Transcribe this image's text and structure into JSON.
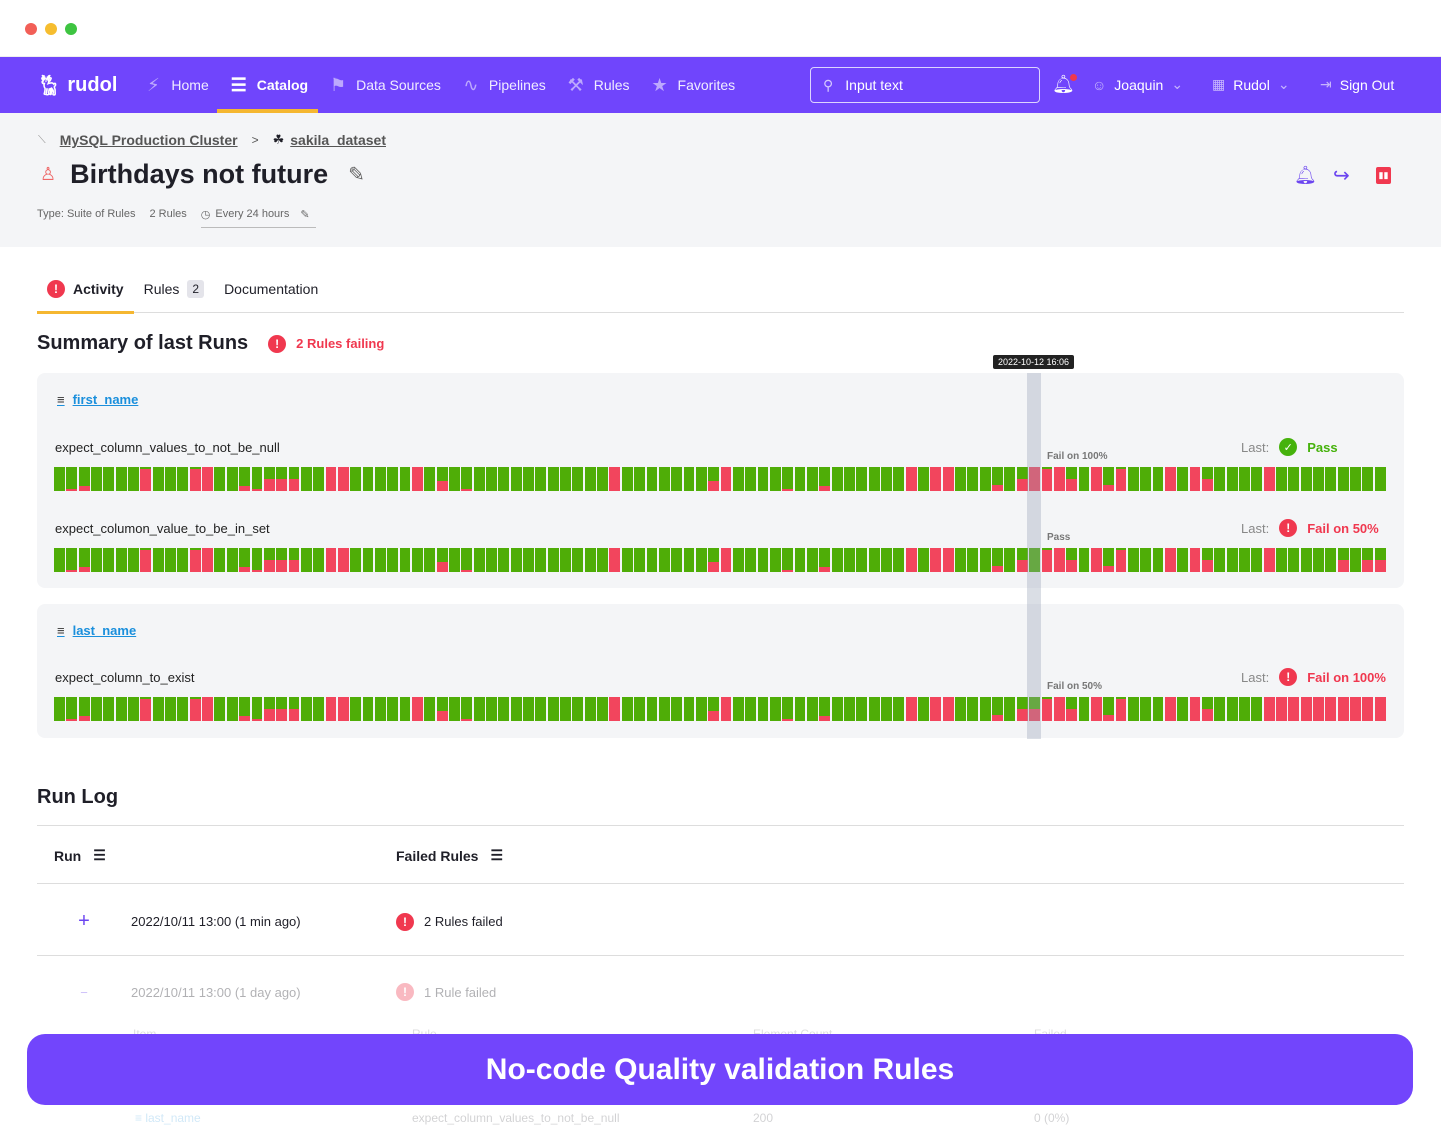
{
  "window": {
    "dots": [
      "#f25f57",
      "#f6bd2f",
      "#3ec441"
    ]
  },
  "nav": {
    "brand": "rudol",
    "items": [
      {
        "label": "Home",
        "icon": "lightning-icon"
      },
      {
        "label": "Catalog",
        "icon": "list-icon",
        "active": true
      },
      {
        "label": "Data Sources",
        "icon": "flag-icon"
      },
      {
        "label": "Pipelines",
        "icon": "route-icon"
      },
      {
        "label": "Rules",
        "icon": "tools-icon"
      },
      {
        "label": "Favorites",
        "icon": "star-icon"
      }
    ],
    "search_placeholder": "Input text",
    "user": "Joaquin",
    "org": "Rudol",
    "signout": "Sign Out"
  },
  "breadcrumb": {
    "source": "MySQL Production Cluster",
    "sep": ">",
    "dataset": "sakila_dataset"
  },
  "page": {
    "title": "Birthdays not future",
    "type": "Type: Suite of Rules",
    "rules_count": "2 Rules",
    "schedule": "Every 24 hours"
  },
  "tabs": [
    {
      "label": "Activity",
      "active": true
    },
    {
      "label": "Rules",
      "badge": "2"
    },
    {
      "label": "Documentation"
    }
  ],
  "summary": {
    "title": "Summary of last Runs",
    "failing": "2 Rules failing",
    "tooltip": "2022-10-12 16:06",
    "last_label": "Last:",
    "highlight_index": 79,
    "groups": [
      {
        "column": "first_name",
        "rules": [
          {
            "name": "expect_column_values_to_not_be_null",
            "hover": "Fail on 100%",
            "last": "Pass",
            "last_status": "pass",
            "fail": [
              0,
              0.1,
              0.2,
              0,
              0,
              0,
              0,
              0.9,
              0,
              0,
              0,
              0.9,
              1,
              0,
              0,
              0.2,
              0.1,
              0.5,
              0.5,
              0.5,
              0,
              0,
              1,
              1,
              0,
              0,
              0,
              0,
              0,
              1,
              0,
              0.4,
              0,
              0.1,
              0,
              0,
              0,
              0,
              0,
              0,
              0,
              0,
              0,
              0,
              0,
              1,
              0,
              0,
              0,
              0,
              0,
              0,
              0,
              0.4,
              1,
              0,
              0,
              0,
              0,
              0.1,
              0,
              0,
              0.2,
              0,
              0,
              0,
              0,
              0,
              0,
              1,
              0,
              1,
              1,
              0,
              0,
              0,
              0.25,
              0,
              0.5,
              1,
              0.9,
              1,
              0.5,
              0,
              1,
              0.25,
              0.9,
              0,
              0,
              0,
              1,
              0,
              1,
              0.5,
              0,
              0,
              0,
              0,
              1,
              0,
              0,
              0,
              0,
              0,
              0,
              0,
              0,
              0
            ]
          },
          {
            "name": "expect_columon_value_to_be_in_set",
            "hover": "Pass",
            "last": "Fail on 50%",
            "last_status": "fail",
            "fail": [
              0,
              0.1,
              0.2,
              0,
              0,
              0,
              0,
              0.9,
              0,
              0,
              0,
              0.9,
              1,
              0,
              0,
              0.2,
              0.1,
              0.5,
              0.5,
              0.5,
              0,
              0,
              1,
              1,
              0,
              0,
              0,
              0,
              0,
              0,
              0,
              0.4,
              0,
              0.1,
              0,
              0,
              0,
              0,
              0,
              0,
              0,
              0,
              0,
              0,
              0,
              1,
              0,
              0,
              0,
              0,
              0,
              0,
              0,
              0.4,
              1,
              0,
              0,
              0,
              0,
              0.1,
              0,
              0,
              0.2,
              0,
              0,
              0,
              0,
              0,
              0,
              1,
              0,
              1,
              1,
              0,
              0,
              0,
              0.25,
              0,
              0.5,
              0,
              0.9,
              1,
              0.5,
              0,
              1,
              0.25,
              0.9,
              0,
              0,
              0,
              1,
              0,
              1,
              0.5,
              0,
              0,
              0,
              0,
              1,
              0,
              0,
              0,
              0,
              0,
              0.5,
              0,
              0.5,
              0.5
            ]
          }
        ]
      },
      {
        "column": "last_name",
        "rules": [
          {
            "name": "expect_column_to_exist",
            "hover": "Fail on 50%",
            "last": "Fail on 100%",
            "last_status": "fail",
            "fail": [
              0,
              0.1,
              0.2,
              0,
              0,
              0,
              0,
              0.9,
              0,
              0,
              0,
              0.9,
              1,
              0,
              0,
              0.2,
              0.1,
              0.5,
              0.5,
              0.5,
              0,
              0,
              1,
              1,
              0,
              0,
              0,
              0,
              0,
              1,
              0,
              0.4,
              0,
              0.1,
              0,
              0,
              0,
              0,
              0,
              0,
              0,
              0,
              0,
              0,
              0,
              1,
              0,
              0,
              0,
              0,
              0,
              0,
              0,
              0.4,
              1,
              0,
              0,
              0,
              0,
              0.1,
              0,
              0,
              0.2,
              0,
              0,
              0,
              0,
              0,
              0,
              1,
              0,
              1,
              1,
              0,
              0,
              0,
              0.25,
              0,
              0.5,
              0.5,
              0.9,
              1,
              0.5,
              0,
              1,
              0.25,
              0.9,
              0,
              0,
              0,
              1,
              0,
              1,
              0.5,
              0,
              0,
              0,
              0,
              1,
              1,
              1,
              1,
              1,
              1,
              1,
              1,
              1,
              1
            ]
          }
        ]
      }
    ]
  },
  "runlog": {
    "title": "Run Log",
    "headers": [
      "Run",
      "Failed Rules"
    ],
    "rows": [
      {
        "toggle": "+",
        "run": "2022/10/11 13:00 (1 min ago)",
        "failed": "2 Rules failed"
      },
      {
        "toggle": "−",
        "run": "2022/10/11 13:00 (1 day ago)",
        "failed": "1 Rule failed"
      }
    ],
    "detail_headers": [
      "Item",
      "Rule",
      "Element Count",
      "Failed"
    ],
    "detail_row": {
      "item": "last_name",
      "rule": "expect_column_values_to_not_be_null",
      "count": "200",
      "failed": "0 (0%)"
    }
  },
  "banner": "No-code Quality validation Rules",
  "colors": {
    "brand": "#7045fc",
    "pass": "#4fad07",
    "fail": "#f2455d",
    "accent": "#f5b731"
  }
}
